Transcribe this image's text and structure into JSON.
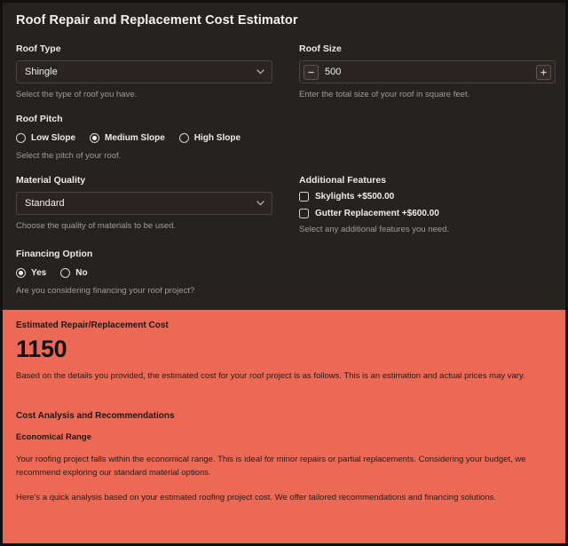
{
  "header": {
    "title": "Roof Repair and Replacement Cost Estimator"
  },
  "form": {
    "roof_type": {
      "label": "Roof Type",
      "value": "Shingle",
      "help": "Select the type of roof you have.",
      "icon": "chevron-down-icon"
    },
    "roof_size": {
      "label": "Roof Size",
      "value": "500",
      "help": "Enter the total size of your roof in square feet.",
      "decrement_label": "−",
      "increment_label": "+"
    },
    "roof_pitch": {
      "label": "Roof Pitch",
      "help": "Select the pitch of your roof.",
      "options": [
        {
          "label": "Low Slope",
          "selected": false
        },
        {
          "label": "Medium Slope",
          "selected": true
        },
        {
          "label": "High Slope",
          "selected": false
        }
      ]
    },
    "material_quality": {
      "label": "Material Quality",
      "value": "Standard",
      "help": "Choose the quality of materials to be used.",
      "icon": "chevron-down-icon"
    },
    "additional_features": {
      "label": "Additional Features",
      "help": "Select any additional features you need.",
      "options": [
        {
          "label": "Skylights +$500.00",
          "checked": false
        },
        {
          "label": "Gutter Replacement +$600.00",
          "checked": false
        }
      ]
    },
    "financing_option": {
      "label": "Financing Option",
      "help": "Are you considering financing your roof project?",
      "options": [
        {
          "label": "Yes",
          "selected": true
        },
        {
          "label": "No",
          "selected": false
        }
      ]
    }
  },
  "result": {
    "title": "Estimated Repair/Replacement Cost",
    "amount": "1150",
    "note": "Based on the details you provided, the estimated cost for your roof project is as follows. This is an estimation and actual prices may vary.",
    "analysis_heading": "Cost Analysis and Recommendations",
    "analysis_sub": "Economical Range",
    "analysis_p1": "Your roofing project falls within the economical range. This is ideal for minor repairs or partial replacements. Considering your budget, we recommend exploring our standard material options.",
    "analysis_p2": "Here's a quick analysis based on your estimated roofing project cost. We offer tailored recommendations and financing solutions."
  },
  "colors": {
    "background": "#262220",
    "accent": "#ec6a55",
    "input_border": "#4a443f",
    "text": "#f2efec",
    "help_text": "#a29c97"
  }
}
